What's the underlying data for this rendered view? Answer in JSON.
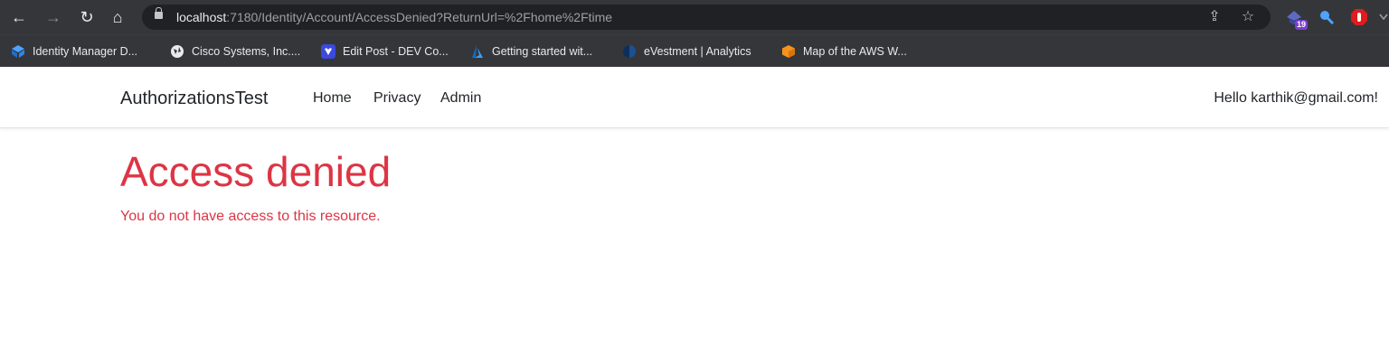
{
  "browser": {
    "url_host": "localhost",
    "url_rest": ":7180/Identity/Account/AccessDenied?ReturnUrl=%2Fhome%2Ftime",
    "nav_icons": {
      "back": "←",
      "forward": "→",
      "reload": "↻",
      "home": "⌂"
    },
    "omnibox_icons": {
      "share": "⇪",
      "star": "☆"
    },
    "extensions": [
      {
        "name": "extension-badge",
        "badge": "19"
      }
    ],
    "bookmarks": [
      {
        "label": "Identity Manager D...",
        "icon_color": "#4da3ff"
      },
      {
        "label": "Cisco Systems, Inc....",
        "icon_color": "#e8eaed"
      },
      {
        "label": "Edit Post - DEV Co...",
        "icon_color": "#3b49df"
      },
      {
        "label": "Getting started wit...",
        "icon_color": "#1a73e8"
      },
      {
        "label": "eVestment | Analytics",
        "icon_color": "#1d4f91"
      },
      {
        "label": "Map of the AWS W...",
        "icon_color": "#f6921e"
      }
    ]
  },
  "site": {
    "brand": "AuthorizationsTest",
    "nav": [
      {
        "label": "Home"
      },
      {
        "label": "Privacy"
      },
      {
        "label": "Admin"
      }
    ],
    "user_greeting": "Hello karthik@gmail.com!"
  },
  "main": {
    "title": "Access denied",
    "message": "You do not have access to this resource."
  },
  "colors": {
    "danger": "#dc3545",
    "chrome": "#35363a",
    "omnibox": "#202124"
  }
}
